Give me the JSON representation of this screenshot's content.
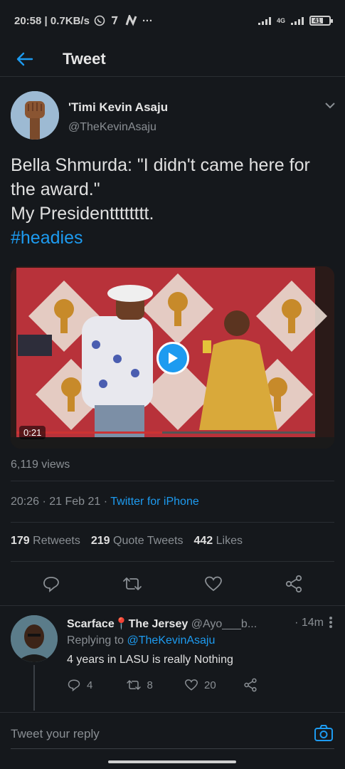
{
  "status_bar": {
    "time_speed": "20:58 | 0.7KB/s",
    "network": "4G",
    "battery": "41"
  },
  "header": {
    "title": "Tweet"
  },
  "tweet": {
    "author_name": "'Timi Kevin Asaju",
    "author_handle": "@TheKevinAsaju",
    "text_lines": [
      "Bella Shmurda: \"I didn't came here for",
      "the award.\"",
      "My Presidentttttttt."
    ],
    "hashtag": "#headies",
    "video_duration": "0:21",
    "views": "6,119 views",
    "time": "20:26 · 21 Feb 21 · ",
    "source": "Twitter for iPhone",
    "retweets_count": "179",
    "retweets_label": "Retweets",
    "quote_count": "219",
    "quote_label": "Quote Tweets",
    "likes_count": "442",
    "likes_label": "Likes"
  },
  "reply": {
    "name": "Scarface📍The Jersey",
    "handle": "@Ayo___b...",
    "time": "· 14m",
    "replying_prefix": "Replying to ",
    "replying_to": "@TheKevinAsaju",
    "text": "4 years in LASU is really Nothing",
    "reply_count": "4",
    "retweet_count": "8",
    "like_count": "20"
  },
  "compose": {
    "placeholder": "Tweet your reply"
  },
  "colors": {
    "accent": "#1d9bf0",
    "background": "#15181c",
    "muted": "#8a8f94"
  }
}
